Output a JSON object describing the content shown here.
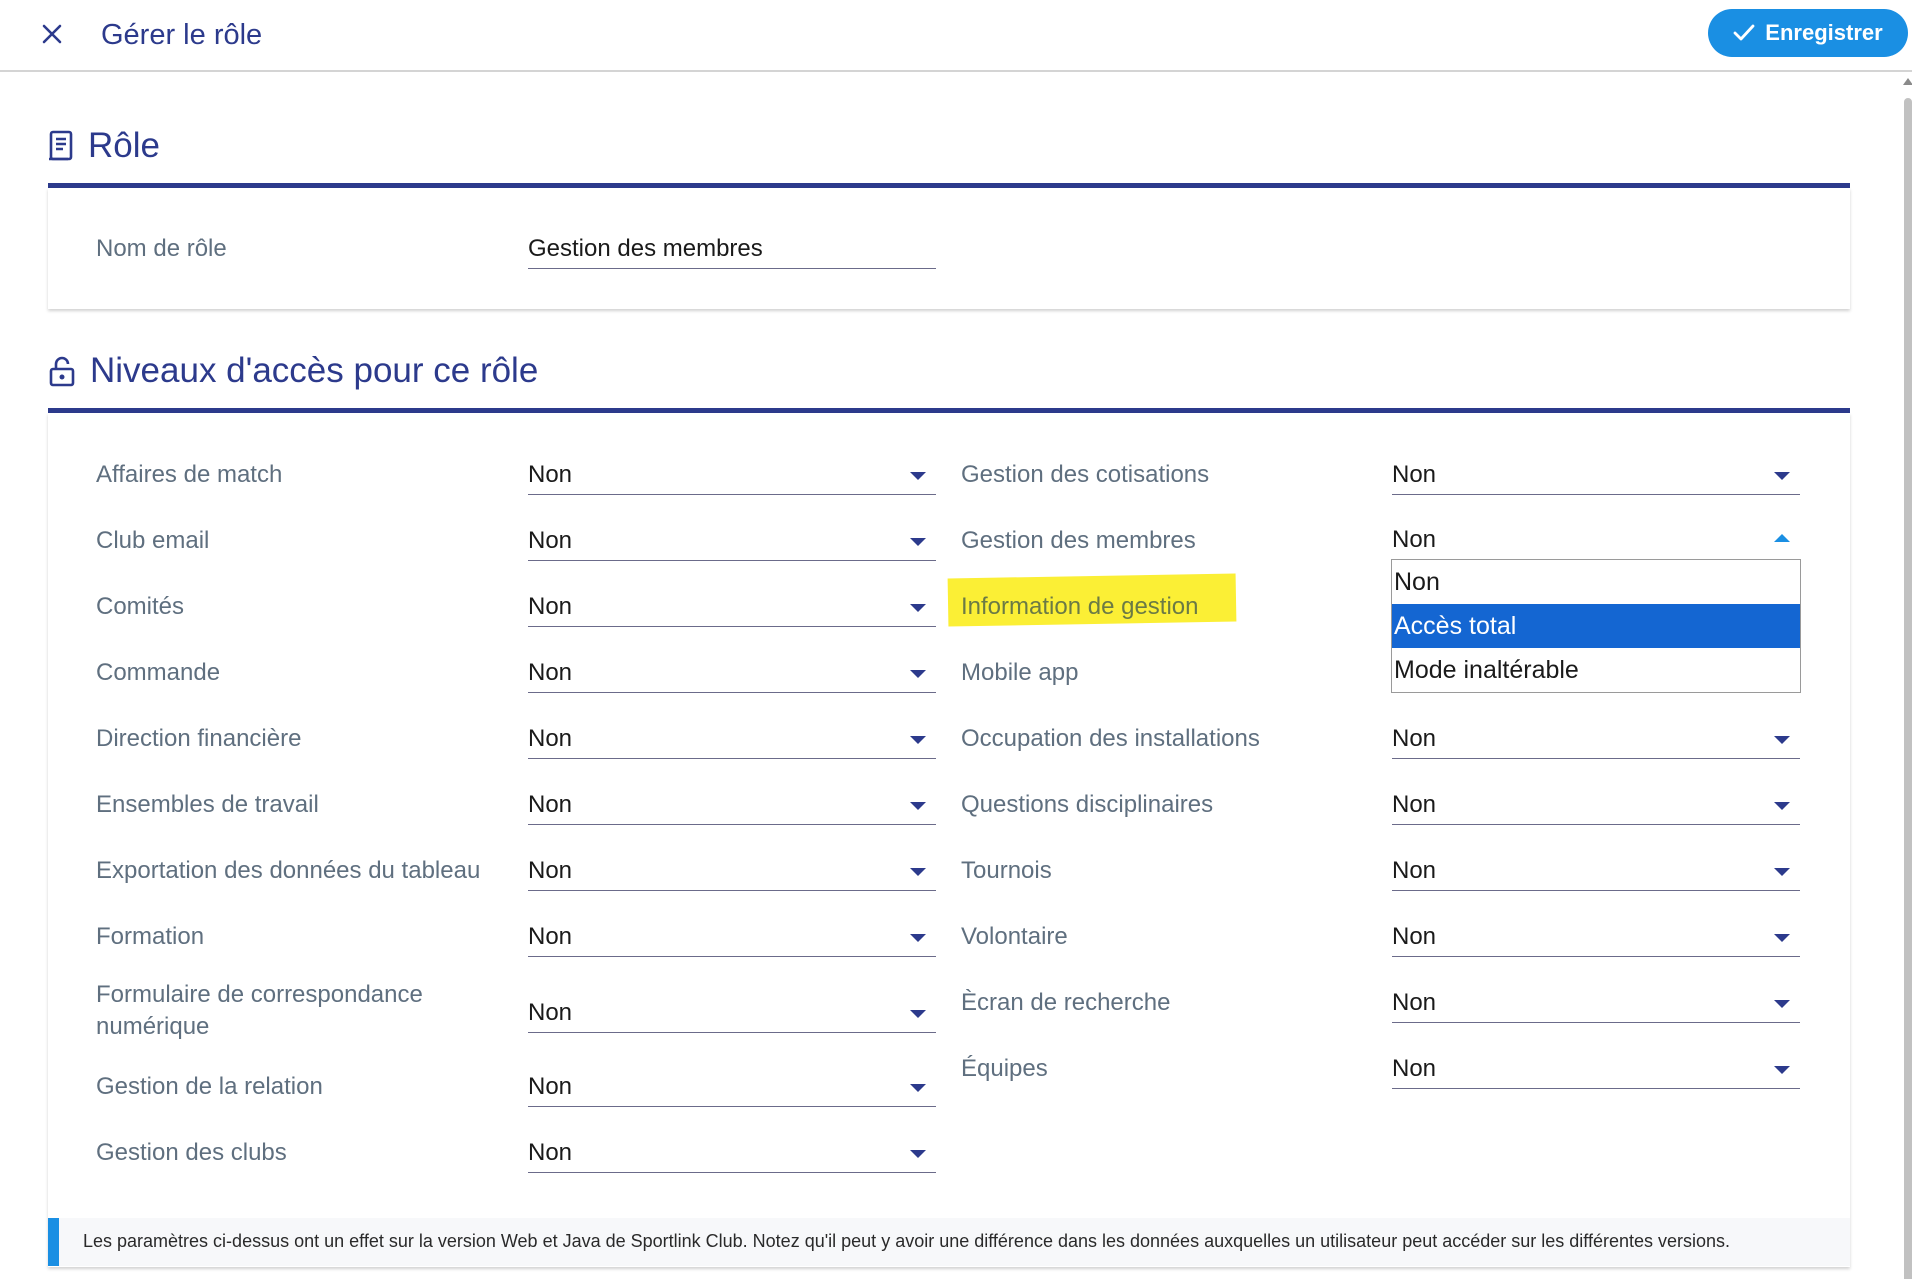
{
  "header": {
    "title": "Gérer le rôle",
    "save_label": "Enregistrer"
  },
  "role_section": {
    "title": "Rôle",
    "name_label": "Nom de rôle",
    "name_value": "Gestion des membres"
  },
  "access_section": {
    "title": "Niveaux d'accès pour ce rôle",
    "left_rows": [
      {
        "label": "Affaires de match",
        "value": "Non"
      },
      {
        "label": "Club email",
        "value": "Non"
      },
      {
        "label": "Comités",
        "value": "Non"
      },
      {
        "label": "Commande",
        "value": "Non"
      },
      {
        "label": "Direction financière",
        "value": "Non"
      },
      {
        "label": "Ensembles de travail",
        "value": "Non"
      },
      {
        "label": "Exportation des données du tableau",
        "value": "Non"
      },
      {
        "label": "Formation",
        "value": "Non"
      },
      {
        "label": "Formulaire de correspondance numérique",
        "value": "Non"
      },
      {
        "label": "Gestion de la relation",
        "value": "Non"
      },
      {
        "label": "Gestion des clubs",
        "value": "Non"
      }
    ],
    "right_rows": [
      {
        "label": "Gestion des cotisations",
        "value": "Non"
      },
      {
        "label": "Gestion des membres",
        "value": "Non"
      },
      {
        "label": "Information de gestion",
        "value": ""
      },
      {
        "label": "Mobile app",
        "value": ""
      },
      {
        "label": "Occupation des installations",
        "value": "Non"
      },
      {
        "label": "Questions disciplinaires",
        "value": "Non"
      },
      {
        "label": "Tournois",
        "value": "Non"
      },
      {
        "label": "Volontaire",
        "value": "Non"
      },
      {
        "label": "Ècran de recherche",
        "value": "Non"
      },
      {
        "label": "Équipes",
        "value": "Non"
      }
    ],
    "open_dropdown": {
      "options": [
        "Non",
        "Accès total",
        "Mode inaltérable"
      ],
      "selected": "Accès total"
    }
  },
  "info_text": "Les paramètres ci-dessus ont un effet sur la version Web et Java de Sportlink Club. Notez qu'il peut y avoir une différence dans les données auxquelles un utilisateur peut accéder sur les différentes versions.",
  "colors": {
    "primary": "#2c3a8c",
    "accent": "#1a8fe3",
    "selected_option": "#1466d2",
    "highlight": "#fbef35"
  }
}
